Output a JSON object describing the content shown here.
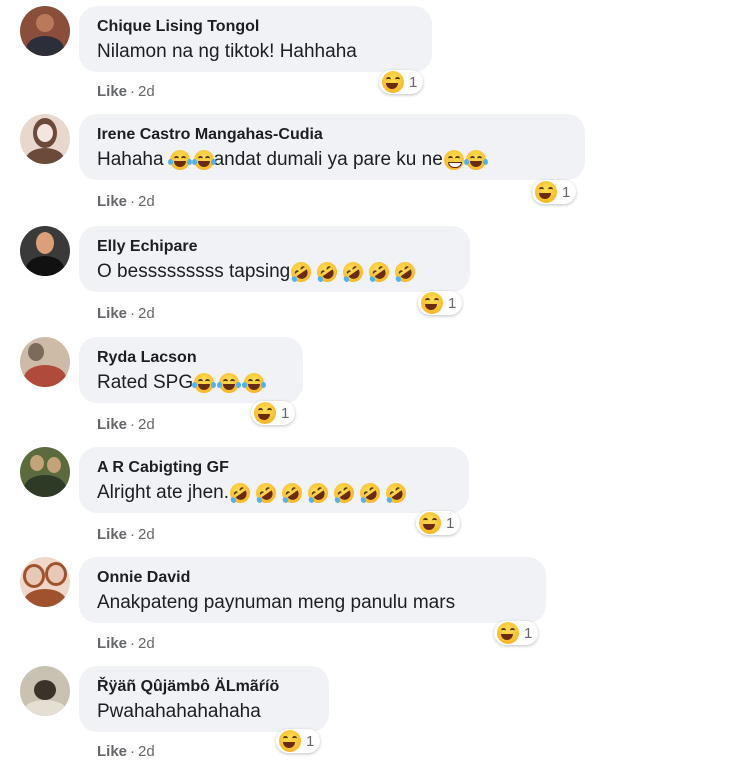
{
  "comments": [
    {
      "name": "Chique Lising Tongol",
      "text": "Nilamon na ng tiktok! Hahhaha",
      "emojis": [],
      "reaction_count": "1",
      "like": "Like",
      "time": "2d",
      "avatar_colors": [
        "#8b4e3a",
        "#2c2f3a",
        "#b97a5c"
      ]
    },
    {
      "name": "Irene Castro Mangahas-Cudia",
      "text": "Hahaha",
      "emojis": [
        "joy",
        "joy"
      ],
      "text_after": "andat dumali ya pare ku ne",
      "emojis_after": [
        "grin",
        "joy"
      ],
      "reaction_count": "1",
      "like": "Like",
      "time": "2d",
      "avatar_colors": [
        "#e8d7cc",
        "#6b4a3a",
        "#f3e6df"
      ]
    },
    {
      "name": "Elly Echipare",
      "text": "O besssssssss tapsing",
      "emojis": [
        "rofl",
        "rofl",
        "rofl",
        "rofl",
        "rofl"
      ],
      "reaction_count": "1",
      "like": "Like",
      "time": "2d",
      "avatar_colors": [
        "#3a3a3a",
        "#111111",
        "#d9a07a"
      ]
    },
    {
      "name": "Ryda Lacson",
      "text": "Rated SPG",
      "emojis": [
        "joy",
        "joy",
        "joy"
      ],
      "reaction_count": "1",
      "like": "Like",
      "time": "2d",
      "avatar_colors": [
        "#7c6a5a",
        "#b04a3a",
        "#cdbba8"
      ]
    },
    {
      "name": "A R Cabigting GF",
      "text": "Alright ate jhen.",
      "emojis": [
        "rofl",
        "rofl",
        "rofl",
        "rofl",
        "rofl",
        "rofl",
        "rofl"
      ],
      "reaction_count": "1",
      "like": "Like",
      "time": "2d",
      "avatar_colors": [
        "#5c6b3d",
        "#2e3a25",
        "#c4a27a"
      ]
    },
    {
      "name": "Onnie David",
      "text": "Anakpateng paynuman meng panulu mars",
      "emojis": [],
      "reaction_count": "1",
      "like": "Like",
      "time": "2d",
      "avatar_colors": [
        "#e6c9b6",
        "#a0522d",
        "#f1d7c9"
      ]
    },
    {
      "name": "Řÿäñ Qûjämbô ÄLmãŕíö",
      "text": "Pwahahahahahaha",
      "emojis": [],
      "reaction_count": "1",
      "like": "Like",
      "time": "2d",
      "avatar_colors": [
        "#c9c2b2",
        "#3a332a",
        "#e4dfd2"
      ]
    }
  ],
  "reaction_icon": "laugh-reaction-icon",
  "accent_text": "#1c1e21",
  "meta_color": "#65676b",
  "bubble_color": "#f0f2f5"
}
